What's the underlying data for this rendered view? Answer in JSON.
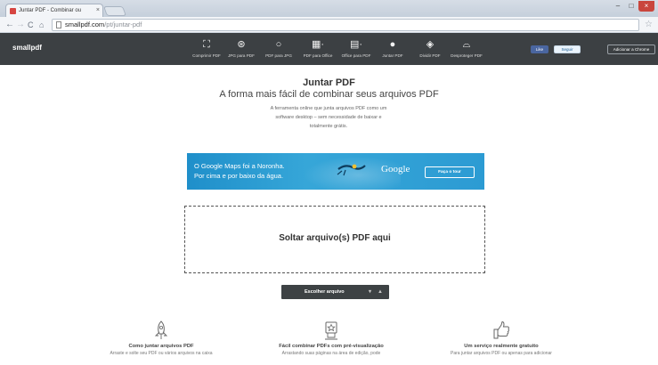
{
  "browser": {
    "tab_title": "Juntar PDF - Combinar ou",
    "tab_close": "×",
    "url_host": "smallpdf.com",
    "url_path": "/pt/juntar-pdf",
    "window_min": "–",
    "window_max": "□",
    "window_close": "×"
  },
  "site": {
    "logo": "smallpdf",
    "nav": [
      {
        "label": "Comprimir PDF",
        "icon": "compress-icon"
      },
      {
        "label": "JPG para PDF",
        "icon": "jpg-to-pdf-icon"
      },
      {
        "label": "PDF para JPG",
        "icon": "pdf-to-jpg-icon"
      },
      {
        "label": "PDF para Office",
        "icon": "pdf-to-office-icon"
      },
      {
        "label": "Office para PDF",
        "icon": "office-to-pdf-icon"
      },
      {
        "label": "Juntar PDF",
        "icon": "merge-pdf-icon"
      },
      {
        "label": "Dividir PDF",
        "icon": "split-pdf-icon"
      },
      {
        "label": "Desproteger PDF",
        "icon": "unlock-pdf-icon"
      }
    ],
    "fb_like": "Like",
    "tw_follow": "Seguir",
    "chrome_add": "Adicionar a Chrome"
  },
  "hero": {
    "title": "Juntar PDF",
    "subtitle": "A forma mais fácil de combinar seus arquivos PDF",
    "desc_line1": "A ferramenta online que junta arquivos PDF como um",
    "desc_line2": "software desktop – sem necessidade de baixar e",
    "desc_line3": "totalmente grátis."
  },
  "ad": {
    "line1": "O Google Maps foi a Noronha.",
    "line2": "Por cima e por baixo da água.",
    "brand": "Google",
    "cta": "Faça o tour"
  },
  "dropzone": {
    "text": "Soltar arquivo(s) PDF aqui"
  },
  "choose": {
    "label": "Escolher arquivo",
    "dropbox_glyph": "▾",
    "drive_glyph": "▲"
  },
  "features": [
    {
      "title": "Como juntar arquivos PDF",
      "desc": "Arraste e solte seu PDF ou vários arquivos na caixa",
      "icon": "rocket-icon"
    },
    {
      "title": "Fácil combinar PDFs com pré-visualização",
      "desc": "Arrastando suas páginas na área de edição, pode",
      "icon": "award-icon"
    },
    {
      "title": "Um serviço realmente gratuito",
      "desc": "Para juntar arquivos PDF ou apenas para adicionar",
      "icon": "thumbs-up-icon"
    }
  ]
}
